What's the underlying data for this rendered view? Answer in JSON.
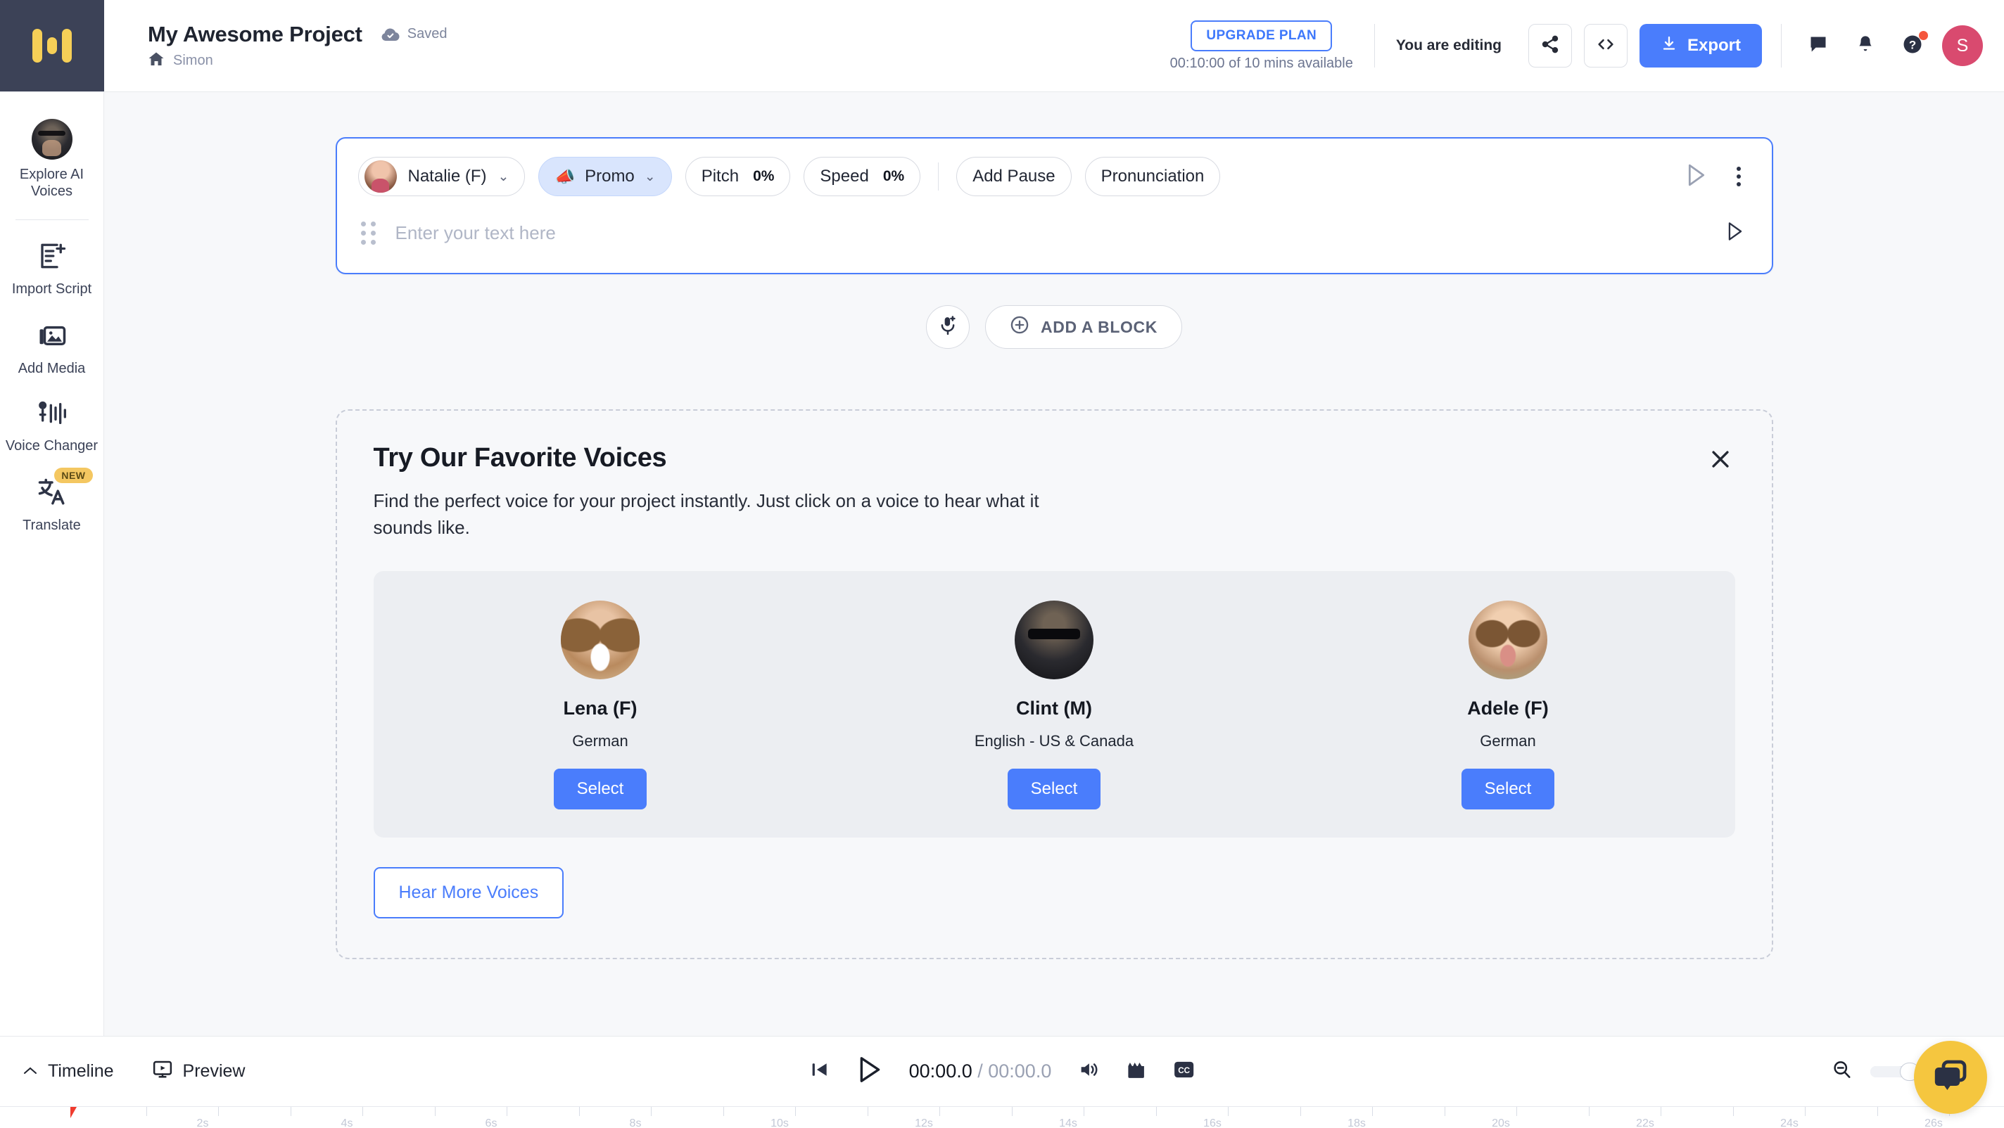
{
  "header": {
    "logo_name": "murf-logo",
    "project_title": "My Awesome Project",
    "saved_label": "Saved",
    "home_label": "Simon",
    "upgrade_label": "UPGRADE PLAN",
    "plan_sub": "00:10:00 of 10 mins available",
    "editing_label": "You are editing",
    "export_label": "Export",
    "avatar_initial": "S",
    "icons": {
      "share": "share-icon",
      "code": "code-icon",
      "download": "download-icon",
      "comment": "comment-icon",
      "bell": "bell-icon",
      "help": "help-icon"
    },
    "accent_blue": "#4a7dfc",
    "avatar_color": "#d94a6f"
  },
  "sidebar": {
    "items": [
      {
        "label": "Explore AI Voices",
        "icon": "voice-avatar-icon"
      },
      {
        "label": "Import Script",
        "icon": "import-script-icon"
      },
      {
        "label": "Add Media",
        "icon": "add-media-icon"
      },
      {
        "label": "Voice Changer",
        "icon": "voice-changer-icon"
      },
      {
        "label": "Translate",
        "icon": "translate-icon",
        "badge": "NEW"
      }
    ]
  },
  "block": {
    "voice_name": "Natalie (F)",
    "style_name": "Promo",
    "style_emoji": "📣",
    "pitch_label": "Pitch",
    "pitch_value": "0%",
    "speed_label": "Speed",
    "speed_value": "0%",
    "add_pause_label": "Add Pause",
    "pronunciation_label": "Pronunciation",
    "text_placeholder": "Enter your text here"
  },
  "add_row": {
    "mic_icon": "microphone-add-icon",
    "add_block_label": "ADD A BLOCK"
  },
  "favorites": {
    "title": "Try Our Favorite Voices",
    "subtitle": "Find the perfect voice for your project instantly. Just click on a voice to hear what it sounds like.",
    "close_icon": "close-icon",
    "select_label": "Select",
    "hear_more_label": "Hear More Voices",
    "voices": [
      {
        "name": "Lena (F)",
        "language": "German",
        "select_label": "Select"
      },
      {
        "name": "Clint (M)",
        "language": "English - US & Canada",
        "select_label": "Select"
      },
      {
        "name": "Adele (F)",
        "language": "German",
        "select_label": "Select"
      }
    ]
  },
  "footer": {
    "timeline_label": "Timeline",
    "preview_label": "Preview",
    "current_time": "00:00.0",
    "separator": " / ",
    "total_time": "00:00.0",
    "icons": {
      "skip_start": "skip-to-start-icon",
      "play": "play-icon",
      "volume": "volume-icon",
      "clapper": "clapperboard-icon",
      "captions": "captions-icon",
      "zoom_out": "zoom-out-icon",
      "chat": "chat-widget-icon"
    },
    "ruler_labels": [
      "2s",
      "4s",
      "6s",
      "8s",
      "10s",
      "12s",
      "14s",
      "16s",
      "18s",
      "20s",
      "22s",
      "24s",
      "26s"
    ]
  }
}
